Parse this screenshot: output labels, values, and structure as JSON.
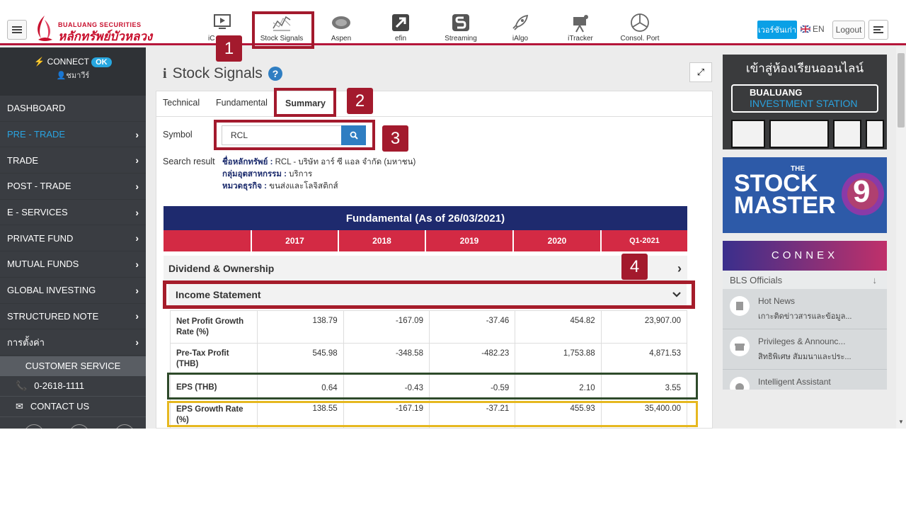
{
  "header": {
    "logo_en": "BUALUANG SECURITIES",
    "logo_th": "หลักทรัพย์บัวหลวง",
    "tools": [
      {
        "label": "iC",
        "icon": "ichart-icon"
      },
      {
        "label": "Stock Signals",
        "icon": "stock-signals-icon"
      },
      {
        "label": "Aspen",
        "icon": "aspen-icon"
      },
      {
        "label": "efin",
        "icon": "efin-icon"
      },
      {
        "label": "Streaming",
        "icon": "streaming-icon"
      },
      {
        "label": "iAlgo",
        "icon": "rocket-icon"
      },
      {
        "label": "iTracker",
        "icon": "itracker-icon"
      },
      {
        "label": "Consol. Port",
        "icon": "pie-icon"
      }
    ],
    "version_button": "เวอร์ชันเก่า",
    "language": "EN",
    "logout": "Logout"
  },
  "sidebar": {
    "connect_label": "CONNECT",
    "connect_status": "OK",
    "user": "ชมาวีร์",
    "items": [
      {
        "label": "DASHBOARD",
        "arrow": false
      },
      {
        "label": "PRE - TRADE",
        "arrow": true
      },
      {
        "label": "TRADE",
        "arrow": true
      },
      {
        "label": "POST - TRADE",
        "arrow": true
      },
      {
        "label": "E - SERVICES",
        "arrow": true
      },
      {
        "label": "PRIVATE FUND",
        "arrow": true
      },
      {
        "label": "MUTUAL FUNDS",
        "arrow": true
      },
      {
        "label": "GLOBAL INVESTING",
        "arrow": true
      },
      {
        "label": "STRUCTURED NOTE",
        "arrow": true
      },
      {
        "label": "การตั้งค่า",
        "arrow": true
      }
    ],
    "customer_service": "CUSTOMER SERVICE",
    "phone": "0-2618-1111",
    "contact": "CONTACT US"
  },
  "main": {
    "title": "Stock Signals",
    "tabs": [
      "Technical",
      "Fundamental",
      "Summary"
    ],
    "symbol_label": "Symbol",
    "symbol_value": "RCL",
    "search_result_label": "Search result",
    "result": {
      "name_key": "ชื่อหลักทรัพย์ :",
      "name_val": "RCL - บริษัท อาร์ ซี แอล จำกัด (มหาชน)",
      "industry_key": "กลุ่มอุตสาหกรรม :",
      "industry_val": "บริการ",
      "sector_key": "หมวดธุรกิจ :",
      "sector_val": "ขนส่งและโลจิสติกส์"
    },
    "fundamental_title": "Fundamental (As of 26/03/2021)",
    "years": [
      "2017",
      "2018",
      "2019",
      "2020",
      "Q1-2021"
    ],
    "section_dividend": "Dividend & Ownership",
    "section_income": "Income Statement",
    "rows": [
      {
        "label": "Net Profit Growth Rate (%)",
        "values": [
          "138.79",
          "-167.09",
          "-37.46",
          "454.82",
          "23,907.00"
        ]
      },
      {
        "label": "Pre-Tax Profit (THB)",
        "values": [
          "545.98",
          "-348.58",
          "-482.23",
          "1,753.88",
          "4,871.53"
        ]
      },
      {
        "label": "EPS (THB)",
        "values": [
          "0.64",
          "-0.43",
          "-0.59",
          "2.10",
          "3.55"
        ]
      },
      {
        "label": "EPS Growth Rate (%)",
        "values": [
          "138.55",
          "-167.19",
          "-37.21",
          "455.93",
          "35,400.00"
        ]
      }
    ]
  },
  "ads": {
    "ad1_title": "เข้าสู่ห้องเรียนออนไลน์",
    "ad1_brand": "BUALUANG",
    "ad1_sub": "INVESTMENT STATION",
    "ad2_the": "THE",
    "ad2_line1": "STOCK",
    "ad2_line2": "MASTER",
    "ad2_num": "9",
    "ad3_brand": "CONNEX",
    "ad3_header": "BLS Officials",
    "feeds": [
      {
        "title": "Hot News",
        "sub": "เกาะติดข่าวสารและข้อมูล..."
      },
      {
        "title": "Privileges & Announc...",
        "sub": "สิทธิพิเศษ สัมมนาและประ..."
      },
      {
        "title": "Intelligent Assistant",
        "sub": ""
      }
    ]
  },
  "callouts": [
    "1",
    "2",
    "3",
    "4"
  ],
  "colors": {
    "brand_red": "#c8102e",
    "navy": "#1e2a6e",
    "accent_blue": "#2aa3e0",
    "callout": "#a31a2d",
    "eps_box": "#2e4a2a",
    "growth_box": "#e6b820"
  }
}
